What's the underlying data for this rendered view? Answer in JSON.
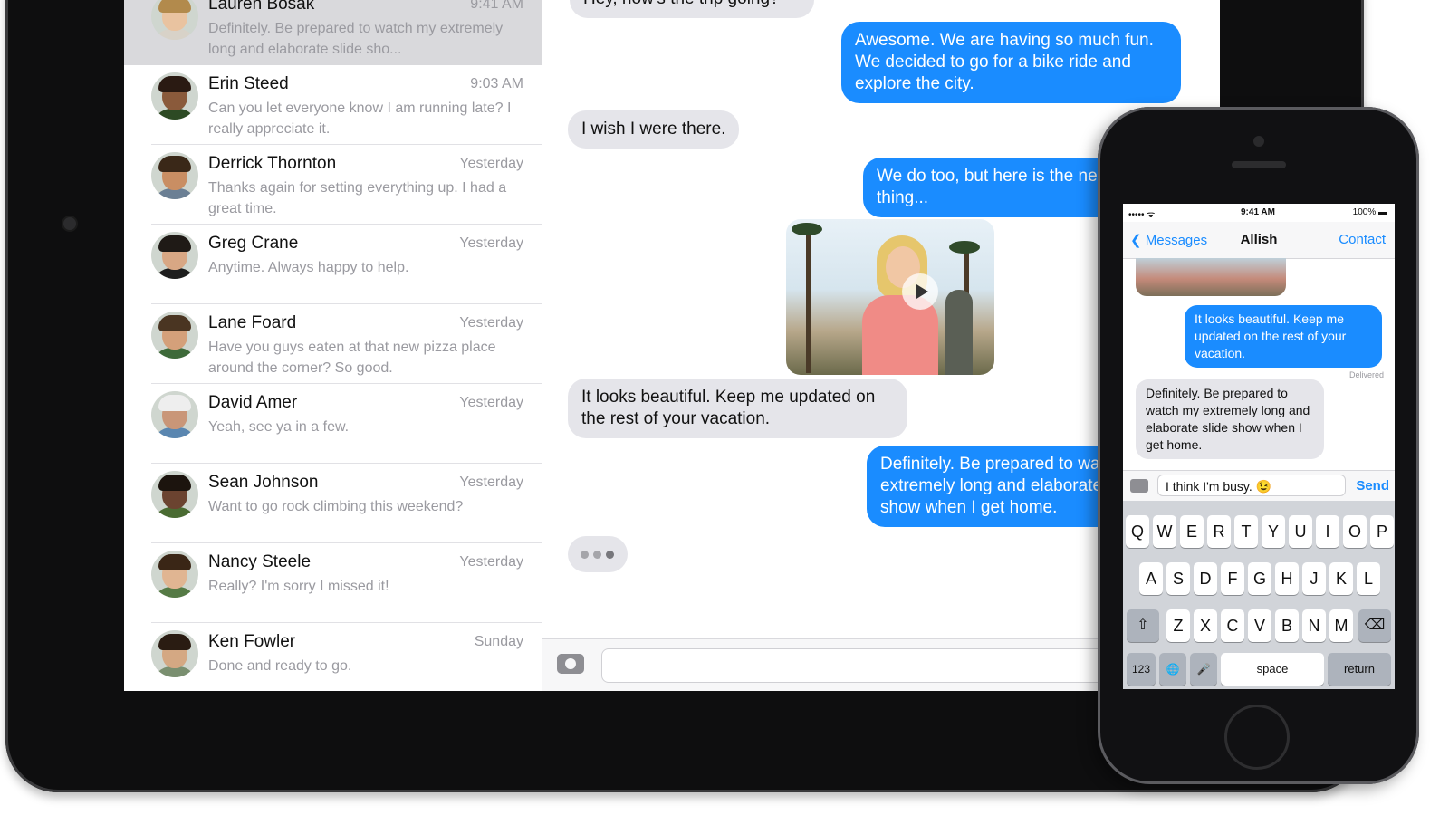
{
  "conversations": [
    {
      "name": "Lauren Bosak",
      "time": "9:41 AM",
      "preview": "Definitely. Be prepared to watch my extremely long and elaborate slide sho...",
      "active": true,
      "skin": "#e9c3a0",
      "hair": "#b28a4c",
      "shirt": "#d8d2c8"
    },
    {
      "name": "Erin Steed",
      "time": "9:03 AM",
      "preview": "Can you let everyone know I am running late? I really appreciate it.",
      "skin": "#8a5a3b",
      "hair": "#2a1a12",
      "shirt": "#2d4a24"
    },
    {
      "name": "Derrick Thornton",
      "time": "Yesterday",
      "preview": "Thanks again for setting everything up. I had a great time.",
      "skin": "#c98e63",
      "hair": "#3a2818",
      "shirt": "#6b7f94"
    },
    {
      "name": "Greg Crane",
      "time": "Yesterday",
      "preview": "Anytime. Always happy to help.",
      "skin": "#d8a784",
      "hair": "#1f1a16",
      "shirt": "#1d1d1d"
    },
    {
      "name": "Lane Foard",
      "time": "Yesterday",
      "preview": "Have you guys eaten at that new pizza place around the corner? So good.",
      "skin": "#d4a07a",
      "hair": "#4a3522",
      "shirt": "#3e6a3a"
    },
    {
      "name": "David Amer",
      "time": "Yesterday",
      "preview": "Yeah, see ya in a few.",
      "skin": "#c99678",
      "hair": "#eeeeee",
      "shirt": "#5a86b0"
    },
    {
      "name": "Sean Johnson",
      "time": "Yesterday",
      "preview": "Want to go rock climbing this weekend?",
      "skin": "#6b4330",
      "hair": "#1c140e",
      "shirt": "#4a6b32"
    },
    {
      "name": "Nancy Steele",
      "time": "Yesterday",
      "preview": "Really? I'm sorry I missed it!",
      "skin": "#e0b592",
      "hair": "#3a2616",
      "shirt": "#557a45"
    },
    {
      "name": "Ken Fowler",
      "time": "Sunday",
      "preview": "Done and ready to go.",
      "skin": "#d4a883",
      "hair": "#2a1c12",
      "shirt": "#7a8f70"
    }
  ],
  "chat": {
    "partial_top": "Hey, how's the trip going?",
    "msg1": "Awesome. We are having so much fun. We decided to go for a bike ride and explore the city.",
    "msg2": "I wish I were there.",
    "msg3": "We do too, but here is the next thing...",
    "msg4": "It looks beautiful. Keep me updated on the rest of your vacation.",
    "msg5": "Definitely. Be prepared to watch my extremely long and elaborate slide show when I get home."
  },
  "phone": {
    "status_signal": "••••• ᯤ",
    "status_time": "9:41 AM",
    "status_battery": "100% ▬",
    "back_label": "Messages",
    "title": "Allish",
    "contact_label": "Contact",
    "msg_out": "It looks beautiful. Keep me updated on the rest of your vacation.",
    "delivered": "Delivered",
    "msg_in": "Definitely. Be prepared to watch my extremely long and elaborate slide show when I get home.",
    "input_value": "I think I'm busy. 😉",
    "send_label": "Send",
    "keys_row1": [
      "Q",
      "W",
      "E",
      "R",
      "T",
      "Y",
      "U",
      "I",
      "O",
      "P"
    ],
    "keys_row2": [
      "A",
      "S",
      "D",
      "F",
      "G",
      "H",
      "J",
      "K",
      "L"
    ],
    "keys_row3": [
      "Z",
      "X",
      "C",
      "V",
      "B",
      "N",
      "M"
    ],
    "key_shift": "⇧",
    "key_delete": "⌫",
    "key_123": "123",
    "key_globe": "🌐",
    "key_mic": "🎤",
    "key_space": "space",
    "key_return": "return"
  },
  "colors": {
    "ios_blue": "#1a8cff",
    "bubble_gray": "#e5e5ea",
    "active_row": "#d9d9dc"
  }
}
